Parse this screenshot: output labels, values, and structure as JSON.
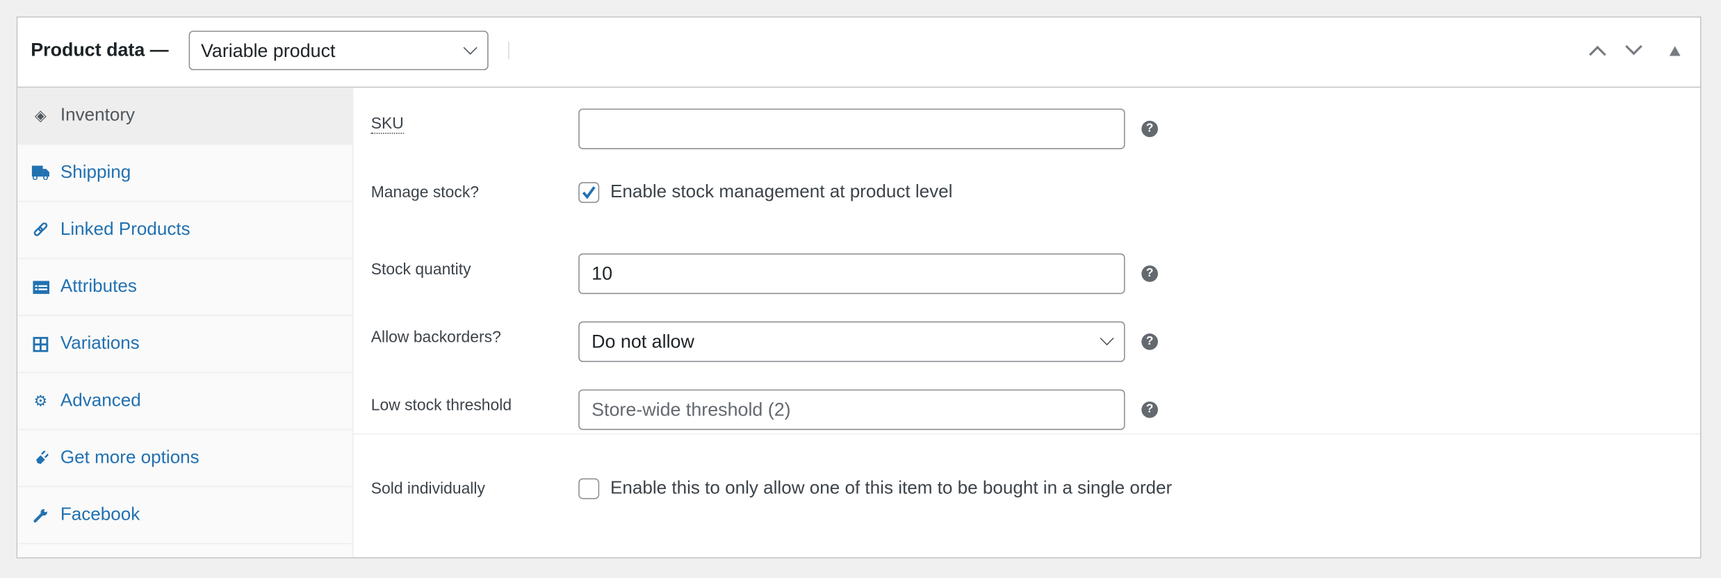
{
  "header": {
    "title": "Product data —",
    "product_type": "Variable product"
  },
  "sidebar": {
    "items": [
      {
        "label": "Inventory",
        "icon": "tag-icon",
        "active": true
      },
      {
        "label": "Shipping",
        "icon": "truck-icon"
      },
      {
        "label": "Linked Products",
        "icon": "link-icon"
      },
      {
        "label": "Attributes",
        "icon": "list-icon"
      },
      {
        "label": "Variations",
        "icon": "grid-icon"
      },
      {
        "label": "Advanced",
        "icon": "gear-icon"
      },
      {
        "label": "Get more options",
        "icon": "plug-icon"
      },
      {
        "label": "Facebook",
        "icon": "wrench-icon"
      }
    ]
  },
  "fields": {
    "sku": {
      "label": "SKU",
      "value": ""
    },
    "manage_stock": {
      "label": "Manage stock?",
      "checkbox_label": "Enable stock management at product level",
      "checked": true
    },
    "stock_quantity": {
      "label": "Stock quantity",
      "value": "10"
    },
    "backorders": {
      "label": "Allow backorders?",
      "value": "Do not allow"
    },
    "low_stock": {
      "label": "Low stock threshold",
      "placeholder": "Store-wide threshold (2)"
    },
    "sold_individually": {
      "label": "Sold individually",
      "checkbox_label": "Enable this to only allow one of this item to be bought in a single order",
      "checked": false
    }
  },
  "help_glyph": "?",
  "colors": {
    "link": "#2271b1",
    "checkmark": "#2271b1"
  }
}
